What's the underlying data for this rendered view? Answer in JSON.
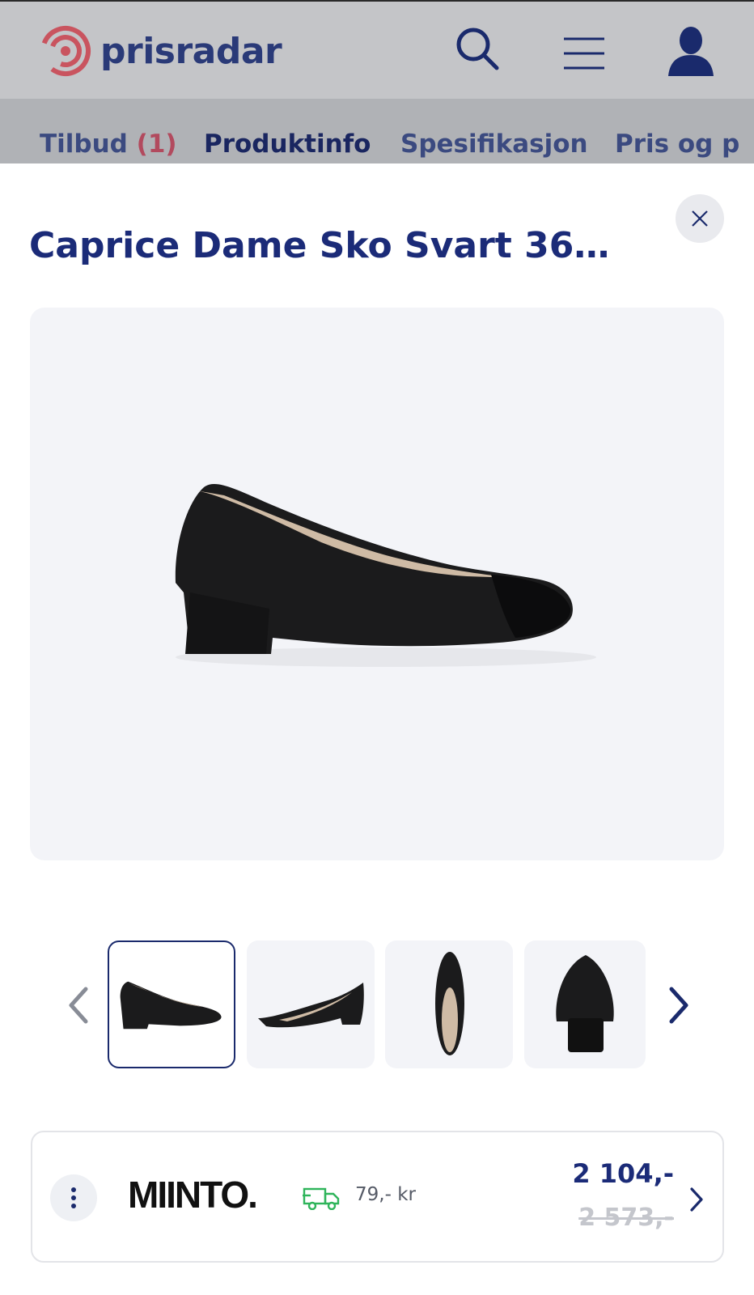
{
  "header": {
    "logo_text": "prisradar",
    "search_icon": "search-icon",
    "menu_icon": "menu-icon",
    "user_icon": "user-icon"
  },
  "tabs": [
    {
      "label": "Tilbud",
      "count": "(1)"
    },
    {
      "label": "Produktinfo"
    },
    {
      "label": "Spesifikasjon"
    },
    {
      "label": "Pris og p"
    }
  ],
  "product": {
    "title": "Caprice Dame Sko Svart 36…",
    "close_icon": "close-icon"
  },
  "gallery": {
    "thumbnail_count": 4,
    "selected_index": 0
  },
  "offer": {
    "shop": "MIINTO.",
    "shipping": "79,- kr",
    "price": "2 104,-",
    "old_price": "2 573,-"
  },
  "colors": {
    "brand_navy": "#1b2b78",
    "logo_red": "#d6334a",
    "shipping_green": "#2eb45a"
  }
}
